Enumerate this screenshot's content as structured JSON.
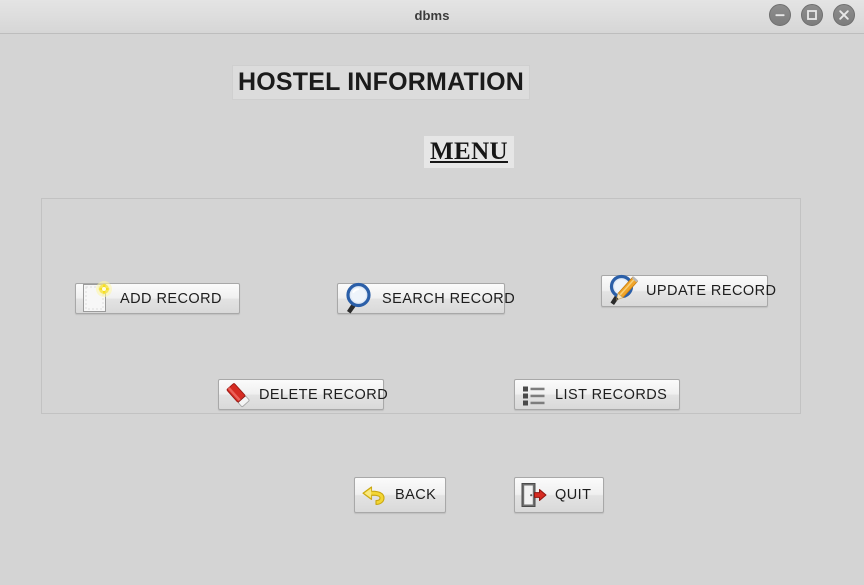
{
  "window": {
    "title": "dbms",
    "controls": [
      {
        "name": "minimize-button",
        "glyph": "minus"
      },
      {
        "name": "maximize-button",
        "glyph": "square"
      },
      {
        "name": "close-button",
        "glyph": "cross"
      }
    ]
  },
  "heading": {
    "title": "HOSTEL INFORMATION",
    "menu_label": "MENU"
  },
  "menu": {
    "buttons": [
      {
        "label": "ADD RECORD",
        "icon": "new-document-icon"
      },
      {
        "label": "SEARCH RECORD",
        "icon": "magnifier-icon"
      },
      {
        "label": "UPDATE RECORD",
        "icon": "magnifier-pencil-icon"
      },
      {
        "label": "DELETE RECORD",
        "icon": "red-eraser-icon"
      },
      {
        "label": "LIST RECORDS",
        "icon": "bulleted-list-icon"
      }
    ]
  },
  "footer": {
    "buttons": [
      {
        "label": "BACK",
        "icon": "back-arrow-icon"
      },
      {
        "label": "QUIT",
        "icon": "exit-door-icon"
      }
    ]
  },
  "colors": {
    "window_background": "#d4d4d4",
    "titlebar": "#dedede",
    "button_face": "#f0f0f0",
    "accent_yellow": "#f2d23a",
    "accent_blue": "#2b5fa8",
    "accent_red": "#d62b22",
    "accent_orange": "#e8941c"
  }
}
